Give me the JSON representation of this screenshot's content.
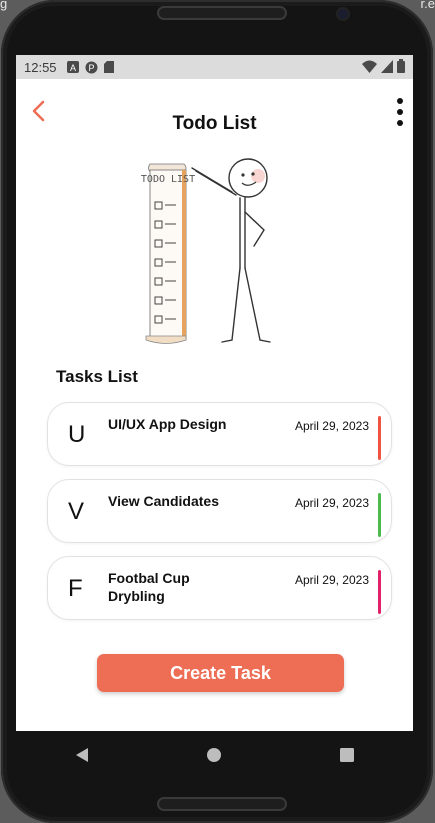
{
  "corner": {
    "left_text": "g",
    "right_text": "r.e"
  },
  "status": {
    "time": "12:55",
    "left_icons": [
      "a-icon",
      "p-icon",
      "sd-card-icon"
    ],
    "right_icons": [
      "wifi-icon",
      "signal-icon",
      "battery-icon"
    ]
  },
  "appbar": {
    "title": "Todo List",
    "back_icon": "chevron-left-icon",
    "menu_icon": "more-vertical-icon"
  },
  "illustration": {
    "banner_text": "TODO LIST"
  },
  "section": {
    "title": "Tasks List"
  },
  "tasks": [
    {
      "initial": "U",
      "title": "UI/UX App Design",
      "date": "April 29, 2023",
      "color": "#f0533f"
    },
    {
      "initial": "V",
      "title": "View Candidates",
      "date": "April 29, 2023",
      "color": "#4cbb4c"
    },
    {
      "initial": "F",
      "title": "Footbal Cup Drybling",
      "date": "April 29, 2023",
      "color": "#e3216b"
    }
  ],
  "create_button": {
    "label": "Create Task",
    "color": "#ee6e55"
  },
  "navbar": {
    "icons": [
      "back-triangle-icon",
      "home-circle-icon",
      "recents-square-icon"
    ]
  }
}
